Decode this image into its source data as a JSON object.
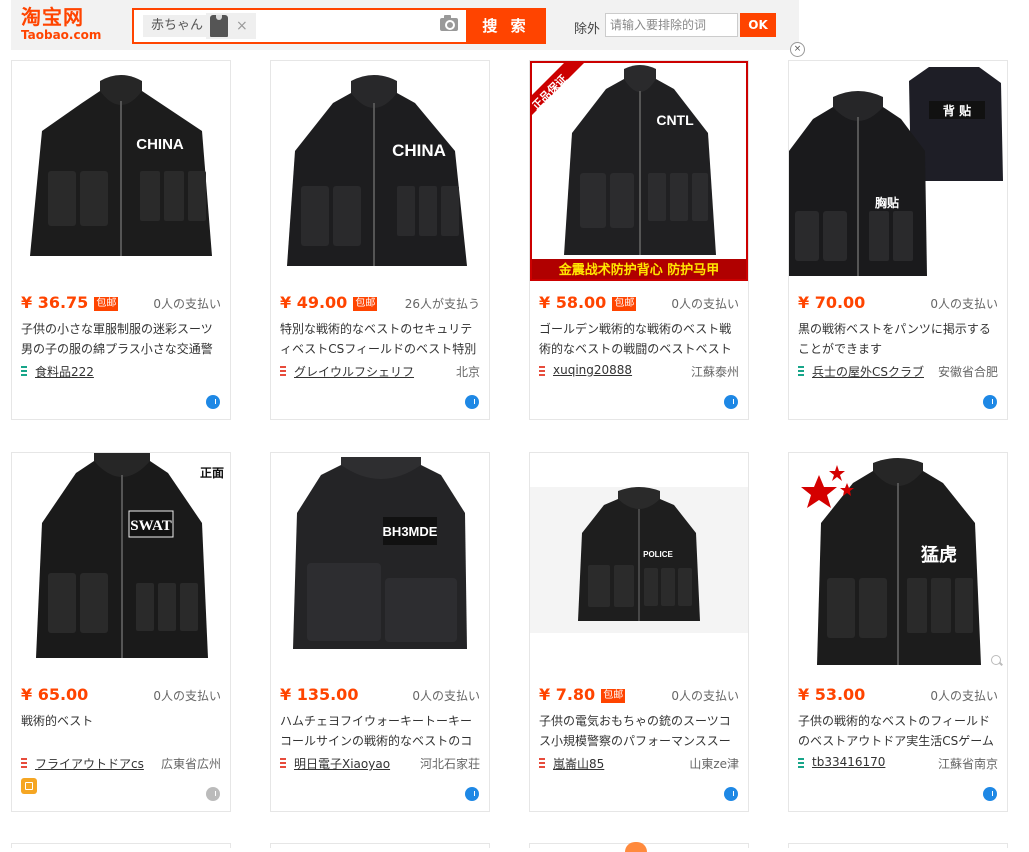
{
  "header": {
    "logo_cn": "淘宝网",
    "logo_en": "Taobao.com",
    "search_keyword": "赤ちゃん",
    "image_remove": "×",
    "search_button": "搜 索",
    "exclude_label": "除外",
    "exclude_placeholder": "请输入要排除的词",
    "ok_button": "OK",
    "close_symbol": "×"
  },
  "products": [
    {
      "price": "¥ 36.75",
      "free_shipping": "包邮",
      "sales": "0人の支払い",
      "title": "子供の小さな軍服制服の迷彩スーツ男の子の服の綿プラス小さな交通警",
      "shop": "食料品222",
      "location": "",
      "shop_color": "#17a589",
      "image_label": "CHINA",
      "online": true
    },
    {
      "price": "¥ 49.00",
      "free_shipping": "包邮",
      "sales": "26人が支払う",
      "title": "特別な戦術的なベストのセキュリティベストCSフィールドのベスト特別",
      "shop": "グレイウルフシェリフ",
      "location": "北京",
      "shop_color": "#e74c3c",
      "image_label": "CHINA",
      "online": true
    },
    {
      "price": "¥ 58.00",
      "free_shipping": "包邮",
      "sales": "0人の支払い",
      "title": "ゴールデン戦術的な戦術のベスト戦術的なベストの戦闘のベストベスト",
      "shop": "xuqing20888",
      "location": "江蘇泰州",
      "shop_color": "#e74c3c",
      "image_label": "CNTL",
      "image_ribbon": "正品保证",
      "image_banner": "金震战术防护背心  防护马甲",
      "online": true
    },
    {
      "price": "¥ 70.00",
      "free_shipping": "",
      "sales": "0人の支払い",
      "title": "黒の戦術ベストをパンツに掲示することができます",
      "shop": "兵士の屋外CSクラブ",
      "location": "安徽省合肥",
      "shop_color": "#17a589",
      "image_label": "胸贴",
      "image_label2": "背 贴",
      "online": true
    },
    {
      "price": "¥ 65.00",
      "free_shipping": "",
      "sales": "0人の支払い",
      "title": "戦術的ベスト",
      "shop": "フライアウトドアcs",
      "location": "広東省広州",
      "shop_color": "#e74c3c",
      "image_label": "SWAT",
      "image_caption": "正面",
      "online": false,
      "has_badge": true
    },
    {
      "price": "¥ 135.00",
      "free_shipping": "",
      "sales": "0人の支払い",
      "title": "ハムチェヨフイウォーキートーキーコールサインの戦術的なベストのコ",
      "shop": "明日電子Xiaoyao",
      "location": "河北石家荘",
      "shop_color": "#e74c3c",
      "image_label": "BH3MDE",
      "online": true
    },
    {
      "price": "¥ 7.80",
      "free_shipping": "包邮",
      "sales": "0人の支払い",
      "title": "子供の電気おもちゃの銃のスーツコス小規模警察のパフォーマンススー",
      "shop": "嵐崙山85",
      "location": "山東ze津",
      "shop_color": "#e74c3c",
      "image_label": "POLICE",
      "online": true
    },
    {
      "price": "¥ 53.00",
      "free_shipping": "",
      "sales": "0人の支払い",
      "title": "子供の戦術的なベストのフィールドのベストアウトドア実生活CSゲーム",
      "shop": "tb33416170",
      "location": "江蘇省南京",
      "shop_color": "#17a589",
      "image_label": "猛虎",
      "online": true
    }
  ]
}
